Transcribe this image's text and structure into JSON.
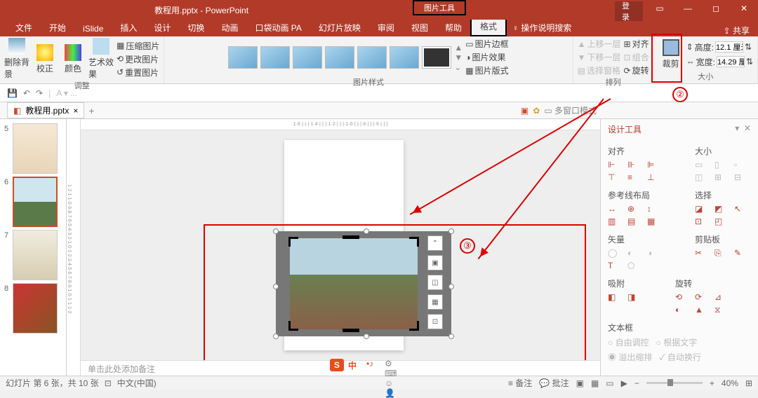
{
  "titlebar": {
    "title": "教程用.pptx - PowerPoint",
    "picture_tools": "图片工具",
    "login": "登录"
  },
  "tabs": {
    "file": "文件",
    "home": "开始",
    "islide": "iSlide",
    "insert": "插入",
    "design": "设计",
    "transition": "切换",
    "animation": "动画",
    "pocket": "口袋动画 PA",
    "slideshow": "幻灯片放映",
    "review": "审阅",
    "view": "视图",
    "help": "帮助",
    "format": "格式",
    "tell": "操作说明搜索",
    "share": "共享"
  },
  "ribbon": {
    "remove_bg": "删除背景",
    "correct": "校正",
    "color": "颜色",
    "artistic": "艺术效果",
    "compress": "压缩图片",
    "change": "更改图片",
    "reset": "重置图片",
    "adjust_label": "调整",
    "styles_label": "图片样式",
    "border": "图片边框",
    "effects": "图片效果",
    "layout": "图片版式",
    "forward": "上移一层",
    "backward": "下移一层",
    "pane": "选择窗格",
    "align": "对齐",
    "group": "组合",
    "rotate": "旋转",
    "arrange_label": "排列",
    "crop": "裁剪",
    "height_label": "高度:",
    "height_val": "12.1 厘米",
    "width_label": "宽度:",
    "width_val": "14.29 厘米",
    "size_label": "大小"
  },
  "doctab": {
    "name": "教程用.pptx",
    "multi": "多窗口模式"
  },
  "thumbs": {
    "n5": "5",
    "n6": "6",
    "n7": "7",
    "n8": "8"
  },
  "notes": {
    "placeholder": "单击此处添加备注"
  },
  "panel": {
    "title": "设计工具",
    "align": "对齐",
    "size": "大小",
    "guides": "参考线布局",
    "select": "选择",
    "vector": "矢量",
    "clipboard": "剪贴板",
    "snap": "吸附",
    "rotation": "旋转",
    "textbox": "文本框",
    "auto": "自由调控",
    "wrap": "根据文字",
    "overflow": "溢出缩排",
    "autowrap": "自动换行"
  },
  "status": {
    "slide": "幻灯片 第 6 张，共 10 张",
    "lang": "中文(中国)",
    "notes": "备注",
    "comments": "批注",
    "zoom": "40%"
  },
  "annot": {
    "c2": "②",
    "c3": "③"
  },
  "taskbar": {
    "ime": "中"
  }
}
